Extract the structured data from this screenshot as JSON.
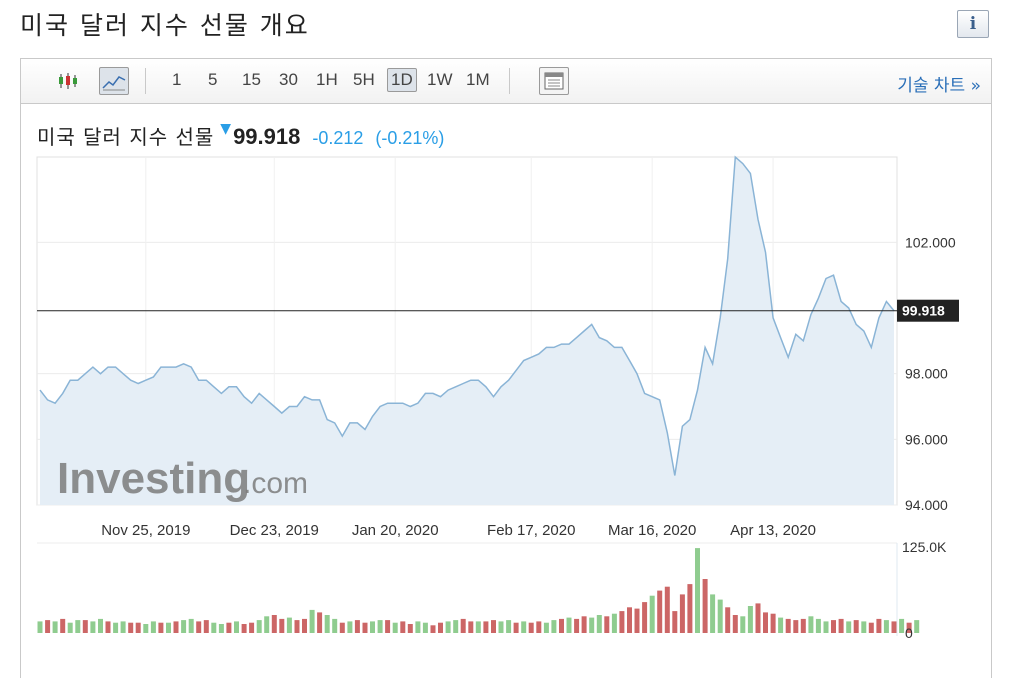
{
  "page": {
    "title": "미국 달러 지수 선물 개요",
    "info_icon": "info-icon"
  },
  "toolbar": {
    "chart_type_icons": [
      "candlestick-icon",
      "line-chart-icon"
    ],
    "intervals": [
      "1",
      "5",
      "15",
      "30",
      "1H",
      "5H",
      "1D",
      "1W",
      "1M"
    ],
    "active_interval": "1D",
    "layout_icon": "layout-icon",
    "tech_chart_link": "기술 차트 »"
  },
  "quote": {
    "name": "미국 달러 지수 선물",
    "direction_icon": "down-arrow-icon",
    "price": "99.918",
    "change": "-0.212",
    "change_pct": "(-0.21%)",
    "change_color": "#2a9ee6"
  },
  "watermark": {
    "brand_main": "Investing",
    "brand_suffix": ".com"
  },
  "chart_data": {
    "type": "area",
    "title": "",
    "xlabel": "",
    "ylabel": "",
    "x_tick_labels": [
      "Nov 25, 2019",
      "Dec 23, 2019",
      "Jan 20, 2020",
      "Feb 17, 2020",
      "Mar 16, 2020",
      "Apr 13, 2020"
    ],
    "y_tick_labels": [
      "102.000",
      "98.000",
      "96.000",
      "94.000"
    ],
    "y_tick_values": [
      102,
      98,
      96,
      94
    ],
    "ylim": [
      94,
      104.6
    ],
    "current_value_label": "99.918",
    "current_value": 99.918,
    "grid": true,
    "series": [
      {
        "color": "#8ab4d6",
        "fill": "#e5eef6",
        "values": [
          97.5,
          97.2,
          97.1,
          97.4,
          97.8,
          97.8,
          98.0,
          98.2,
          98.0,
          98.2,
          98.2,
          98.0,
          97.8,
          97.7,
          97.8,
          97.9,
          98.2,
          98.2,
          98.2,
          98.3,
          98.2,
          97.8,
          97.8,
          97.6,
          97.4,
          97.6,
          97.6,
          97.3,
          97.1,
          97.4,
          97.2,
          97.0,
          96.8,
          97.0,
          97.0,
          97.3,
          97.2,
          97.2,
          96.6,
          96.5,
          96.1,
          96.5,
          96.5,
          96.3,
          96.7,
          97.0,
          97.1,
          97.1,
          97.1,
          97.0,
          97.1,
          97.4,
          97.4,
          97.3,
          97.5,
          97.6,
          97.7,
          97.8,
          97.8,
          97.6,
          97.3,
          97.6,
          97.8,
          98.1,
          98.4,
          98.5,
          98.6,
          98.8,
          98.8,
          98.9,
          98.9,
          99.1,
          99.3,
          99.5,
          99.1,
          99.0,
          98.8,
          98.8,
          98.4,
          98.0,
          97.4,
          97.3,
          97.2,
          96.2,
          94.9,
          96.4,
          96.6,
          97.5,
          98.8,
          98.3,
          99.7,
          101.5,
          104.6,
          104.4,
          104.1,
          102.7,
          101.7,
          99.7,
          99.1,
          98.5,
          99.2,
          99.0,
          99.8,
          100.3,
          100.9,
          101.0,
          100.2,
          100.0,
          99.5,
          99.3,
          98.8,
          99.7,
          100.2,
          99.918
        ]
      }
    ],
    "volume": {
      "y_tick_labels": [
        "125.0K",
        "0"
      ],
      "y_tick_values": [
        125000,
        0
      ],
      "up_color": "#8fcc8f",
      "down_color": "#cc6666",
      "values": [
        9,
        10,
        9,
        11,
        8,
        10,
        10,
        9,
        11,
        9,
        8,
        9,
        8,
        8,
        7,
        9,
        8,
        8,
        9,
        10,
        11,
        9,
        10,
        8,
        7,
        8,
        9,
        7,
        8,
        10,
        13,
        14,
        11,
        12,
        10,
        11,
        18,
        16,
        14,
        11,
        8,
        9,
        10,
        8,
        9,
        10,
        10,
        8,
        9,
        7,
        9,
        8,
        6,
        8,
        9,
        10,
        11,
        9,
        9,
        9,
        10,
        9,
        10,
        8,
        9,
        8,
        9,
        8,
        10,
        11,
        12,
        11,
        13,
        12,
        14,
        13,
        15,
        17,
        20,
        19,
        24,
        29,
        33,
        36,
        17,
        30,
        38,
        66,
        42,
        30,
        26,
        20,
        14,
        13,
        21,
        23,
        16,
        15,
        12,
        11,
        10,
        11,
        13,
        11,
        9,
        10,
        11,
        9,
        10,
        9,
        8,
        11,
        10,
        9,
        11,
        8,
        10
      ],
      "up": [
        1,
        0,
        1,
        0,
        1,
        1,
        0,
        1,
        1,
        0,
        1,
        1,
        0,
        0,
        1,
        1,
        0,
        1,
        0,
        1,
        1,
        0,
        0,
        1,
        1,
        0,
        1,
        0,
        0,
        1,
        1,
        0,
        0,
        1,
        0,
        0,
        1,
        0,
        1,
        1,
        0,
        1,
        0,
        0,
        1,
        1,
        0,
        1,
        0,
        0,
        1,
        1,
        0,
        0,
        1,
        1,
        0,
        0,
        1,
        0,
        0,
        1,
        1,
        0,
        1,
        0,
        0,
        1,
        1,
        0,
        1,
        0,
        0,
        1,
        1,
        0,
        1,
        0,
        0,
        0,
        0,
        1,
        0,
        0,
        0,
        0,
        0,
        1,
        0,
        1,
        1,
        0,
        0,
        1,
        1,
        0,
        0,
        0,
        1,
        0,
        0,
        0,
        1,
        1,
        1,
        0,
        0,
        1,
        0,
        1,
        0,
        0,
        1,
        0,
        1,
        0,
        1
      ]
    }
  }
}
